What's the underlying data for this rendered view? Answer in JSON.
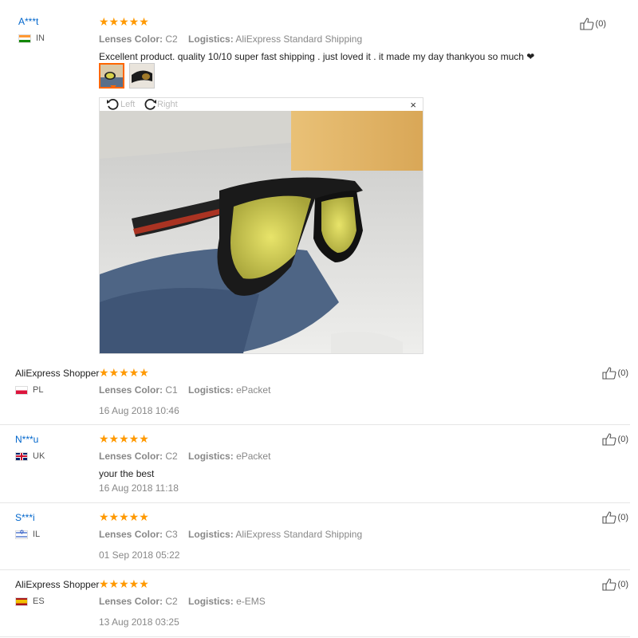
{
  "labels": {
    "lenses_color": "Lenses Color:",
    "logistics": "Logistics:"
  },
  "viewer": {
    "left": "Left",
    "right": "Right",
    "close": "×"
  },
  "heart": "❤",
  "colors": {
    "star": "#ff9900",
    "link": "#0066cc",
    "active_thumb": "#ff6600"
  },
  "reviews": [
    {
      "name": "A***t",
      "country": "IN",
      "stars": "★★★★★",
      "lenses": "C2",
      "logistics": "AliExpress Standard Shipping",
      "text": "Excellent product. quality 10/10 super fast shipping . just loved it . it made my day thankyou so much",
      "likes": "(0)"
    },
    {
      "name": "AliExpress Shopper",
      "country": "PL",
      "stars": "★★★★★",
      "lenses": "C1",
      "logistics": "ePacket",
      "date": "16 Aug 2018 10:46",
      "likes": "(0)"
    },
    {
      "name": "N***u",
      "country": "UK",
      "stars": "★★★★★",
      "lenses": "C2",
      "logistics": "ePacket",
      "text": "your the best",
      "date": "16 Aug 2018 11:18",
      "likes": "(0)"
    },
    {
      "name": "S***i",
      "country": "IL",
      "stars": "★★★★★",
      "lenses": "C3",
      "logistics": "AliExpress Standard Shipping",
      "date": "01 Sep 2018 05:22",
      "likes": "(0)"
    },
    {
      "name": "AliExpress Shopper",
      "country": "ES",
      "stars": "★★★★★",
      "lenses": "C2",
      "logistics": "e-EMS",
      "date": "13 Aug 2018 03:25",
      "likes": "(0)"
    }
  ]
}
